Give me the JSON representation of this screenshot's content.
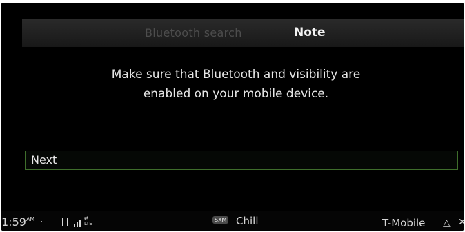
{
  "header": {
    "background_title": "Bluetooth search",
    "title": "Note"
  },
  "dialog": {
    "message_line1": "Make sure that Bluetooth and visibility are",
    "message_line2": "enabled on your mobile device.",
    "next_label": "Next"
  },
  "status": {
    "time": "1:59",
    "ampm": "AM",
    "separator": ".",
    "network": "LTE",
    "radio_source": "SXM",
    "station": "Chill",
    "carrier": "T-Mobile",
    "warning_glyph": "△",
    "close_glyph": "✕"
  },
  "colors": {
    "button_border": "#3f6e2c",
    "background": "#000000"
  }
}
